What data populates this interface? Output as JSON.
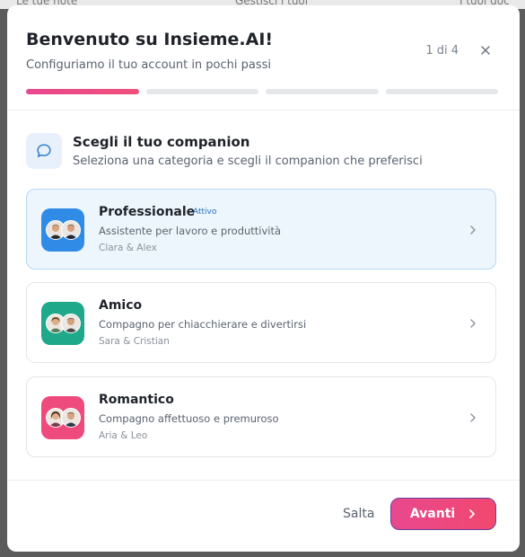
{
  "background": {
    "partial_labels": [
      "Le tue note",
      "Gestisci i tuoi",
      "I tuoi doc"
    ]
  },
  "dialog": {
    "title": "Benvenuto su Insieme.AI!",
    "subtitle": "Configuriamo il tuo account in pochi passi",
    "step_counter": "1 di 4",
    "progress": {
      "current_step": 1,
      "total_steps": 4
    }
  },
  "section": {
    "icon": "chat-bubble-icon",
    "title": "Scegli il tuo companion",
    "subtitle": "Seleziona una categoria e scegli il companion che preferisci"
  },
  "categories": [
    {
      "name": "Professionale",
      "badge": "Attivo",
      "description": "Assistente per lavoro e produttività",
      "companions": "Clara & Alex",
      "color": "#2f8be6",
      "active": true
    },
    {
      "name": "Amico",
      "badge": "",
      "description": "Compagno per chiacchierare e divertirsi",
      "companions": "Sara & Cristian",
      "color": "#1fa88a",
      "active": false
    },
    {
      "name": "Romantico",
      "badge": "",
      "description": "Compagno affettuoso e premuroso",
      "companions": "Aria & Leo",
      "color": "#ee4a7e",
      "active": false
    }
  ],
  "footer": {
    "skip_label": "Salta",
    "next_label": "Avanti"
  },
  "colors": {
    "accent": "#ee4a7e",
    "active_card_bg": "#eef6fd",
    "text_primary": "#1f2329"
  }
}
